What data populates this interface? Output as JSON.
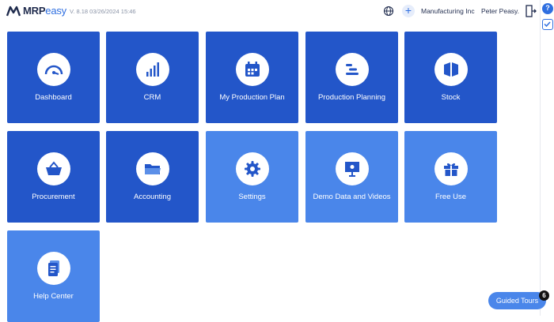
{
  "header": {
    "logo_mrp": "MRP",
    "logo_easy": "easy",
    "version": "V. 8.18  03/26/2024 15:46",
    "company": "Manufacturing Inc",
    "user": "Peter Peasy."
  },
  "tiles": [
    {
      "label": "Dashboard",
      "icon": "gauge-icon",
      "style": "dark"
    },
    {
      "label": "CRM",
      "icon": "bars-icon",
      "style": "dark"
    },
    {
      "label": "My Production Plan",
      "icon": "calendar-icon",
      "style": "dark"
    },
    {
      "label": "Production Planning",
      "icon": "gantt-icon",
      "style": "dark"
    },
    {
      "label": "Stock",
      "icon": "box-icon",
      "style": "dark"
    },
    {
      "label": "Procurement",
      "icon": "basket-icon",
      "style": "dark"
    },
    {
      "label": "Accounting",
      "icon": "folder-icon",
      "style": "dark"
    },
    {
      "label": "Settings",
      "icon": "gear-icon",
      "style": "light"
    },
    {
      "label": "Demo Data and Videos",
      "icon": "presentation-icon",
      "style": "light"
    },
    {
      "label": "Free Use",
      "icon": "gift-icon",
      "style": "light"
    },
    {
      "label": "Help Center",
      "icon": "document-icon",
      "style": "light"
    }
  ],
  "guided_tours": {
    "label": "Guided Tours",
    "count": "6"
  },
  "colors": {
    "tile_dark": "#2356c9",
    "tile_light": "#4a86ea",
    "accent": "#2f6fe0"
  }
}
